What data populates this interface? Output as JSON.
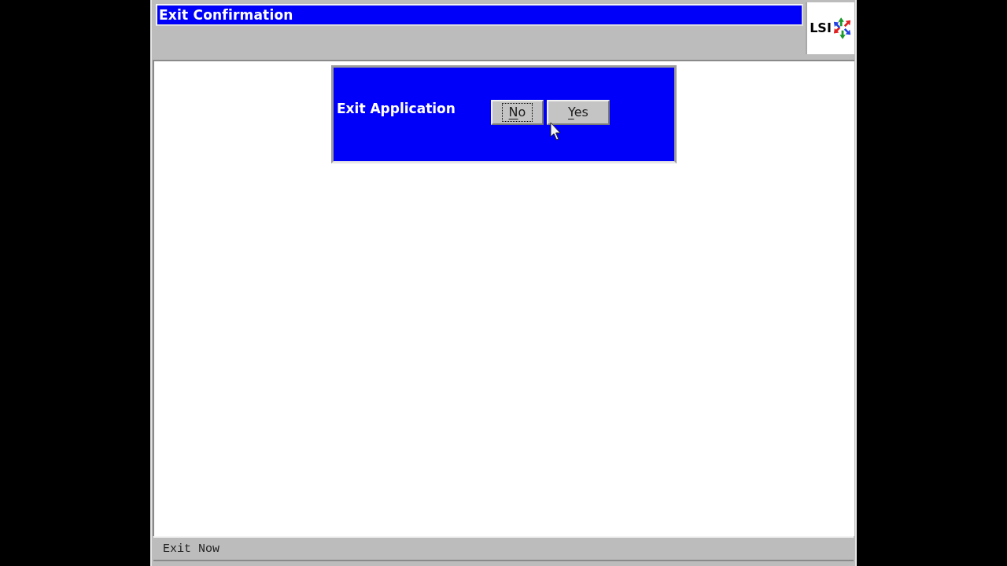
{
  "title_bar": {
    "title": "Exit Confirmation"
  },
  "logo": {
    "text": "LSI"
  },
  "dialog": {
    "label": "Exit Application",
    "buttons": [
      {
        "label": "No",
        "focused": true,
        "access_key_shown": true
      },
      {
        "label": "Yes",
        "focused": false,
        "access_key_shown": true
      }
    ]
  },
  "status_bar": {
    "text": "Exit Now"
  }
}
